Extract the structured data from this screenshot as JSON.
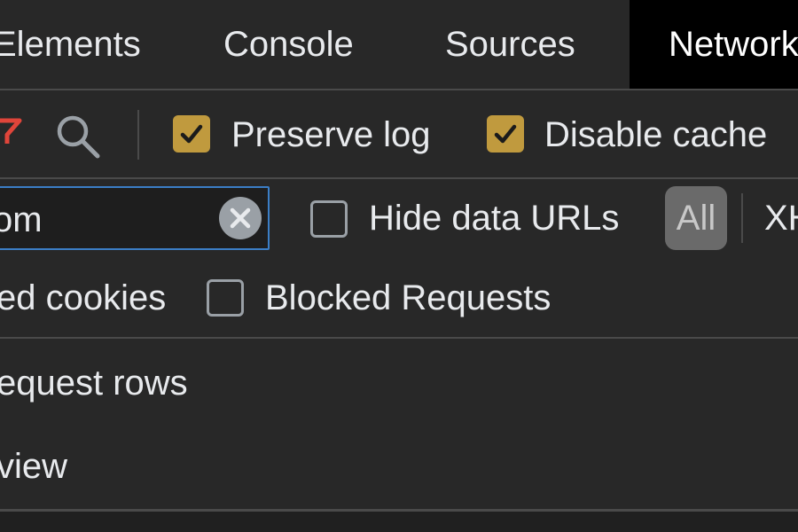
{
  "tabs": {
    "elements": "Elements",
    "console": "Console",
    "sources": "Sources",
    "network": "Network"
  },
  "toolbar": {
    "preserve_log": {
      "label": "Preserve log",
      "checked": true
    },
    "disable_cache": {
      "label": "Disable cache",
      "checked": true
    }
  },
  "filter": {
    "value": "om",
    "hide_data_urls": {
      "label": "Hide data URLs",
      "checked": false
    },
    "type_all": "All",
    "type_xhr": "XHR"
  },
  "options": {
    "blocked_cookies_label": "ed cookies",
    "blocked_requests": {
      "label": "Blocked Requests",
      "checked": false
    }
  },
  "settings": {
    "big_request_rows": "equest rows",
    "overview": "view"
  },
  "colors": {
    "background": "#282828",
    "active_tab": "#000000",
    "checkbox_checked": "#c09a3e",
    "input_focus_border": "#3b7ec6",
    "filter_icon": "#e0453a"
  }
}
